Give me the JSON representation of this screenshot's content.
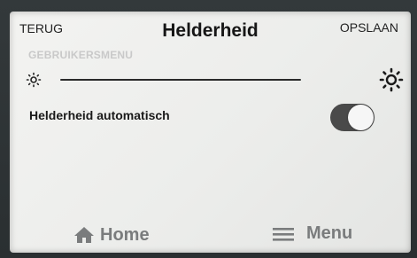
{
  "header": {
    "back_label": "TERUG",
    "title": "Helderheid",
    "save_label": "OPSLAAN"
  },
  "breadcrumb": {
    "label": "GEBRUIKERSMENU"
  },
  "brightness": {
    "min_icon": "sun-small-icon",
    "max_icon": "sun-large-icon"
  },
  "auto_brightness": {
    "label": "Helderheid automatisch",
    "enabled": true
  },
  "bottom_nav": {
    "home_label": "Home",
    "home_icon": "home-icon",
    "menu_label": "Menu",
    "menu_icon": "hamburger-icon"
  },
  "colors": {
    "screen": "#efefed",
    "text": "#1a1a1a",
    "muted_text": "#c9c9c9",
    "nav_text": "#7a7c7d",
    "toggle_on": "#4a4a4a"
  }
}
